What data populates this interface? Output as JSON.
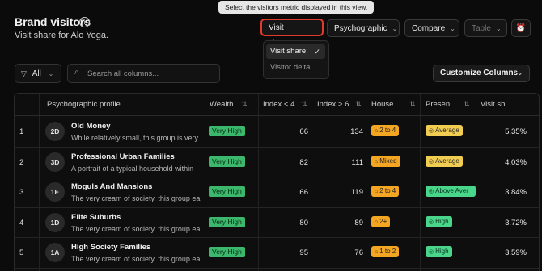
{
  "header": {
    "title": "Brand visitors",
    "subtitle": "Visit share for Alo Yoga."
  },
  "tooltip": "Select the visitors metric displayed in this view.",
  "toolbar": {
    "metric_label": "Visit share",
    "segment_label": "Psychographic",
    "compare_label": "Compare",
    "view_label": "Table"
  },
  "metric_dropdown": {
    "options": [
      "Visit share",
      "Visitor delta"
    ],
    "selected": "Visit share"
  },
  "filters": {
    "filter_label": "All",
    "search_placeholder": "Search all columns...",
    "customize_label": "Customize Columns"
  },
  "table": {
    "columns": [
      "Psychographic profile",
      "Wealth",
      "Index < 4",
      "Index > 6",
      "House...",
      "Presen...",
      "Visit sh..."
    ],
    "rows": [
      {
        "rank": "1",
        "code": "2D",
        "name": "Old Money",
        "desc": "While relatively small, this group is very",
        "wealth": "Very High",
        "idx_lt": "66",
        "idx_gt": "134",
        "household": "2 to 4",
        "household_color": "orange",
        "presence": "Average",
        "presence_color": "yellow",
        "share": "5.35%"
      },
      {
        "rank": "2",
        "code": "3D",
        "name": "Professional Urban Families",
        "desc": "A portrait of a typical household within",
        "wealth": "Very High",
        "idx_lt": "82",
        "idx_gt": "111",
        "household": "Mixed",
        "household_color": "orange",
        "presence": "Average",
        "presence_color": "yellow",
        "share": "4.03%"
      },
      {
        "rank": "3",
        "code": "1E",
        "name": "Moguls And Mansions",
        "desc": "The very cream of society, this group ea",
        "wealth": "Very High",
        "idx_lt": "66",
        "idx_gt": "119",
        "household": "2 to 4",
        "household_color": "orange",
        "presence": "Above Aver",
        "presence_color": "green",
        "share": "3.84%"
      },
      {
        "rank": "4",
        "code": "1D",
        "name": "Elite Suburbs",
        "desc": "The very cream of society, this group ea",
        "wealth": "Very High",
        "idx_lt": "80",
        "idx_gt": "89",
        "household": "2+",
        "household_color": "orange",
        "presence": "High",
        "presence_color": "green",
        "share": "3.72%"
      },
      {
        "rank": "5",
        "code": "1A",
        "name": "High Society Families",
        "desc": "The very cream of society, this group ea",
        "wealth": "Very High",
        "idx_lt": "95",
        "idx_gt": "76",
        "household": "1 to 2",
        "household_color": "orange",
        "presence": "High",
        "presence_color": "green",
        "share": "3.59%"
      }
    ]
  },
  "colors": {
    "accent_border": "#e23b2e",
    "wealth_badge": "#3bb86b",
    "household_badge": "#f4a623",
    "presence_average": "#f1cd52",
    "presence_high": "#49d68a"
  }
}
